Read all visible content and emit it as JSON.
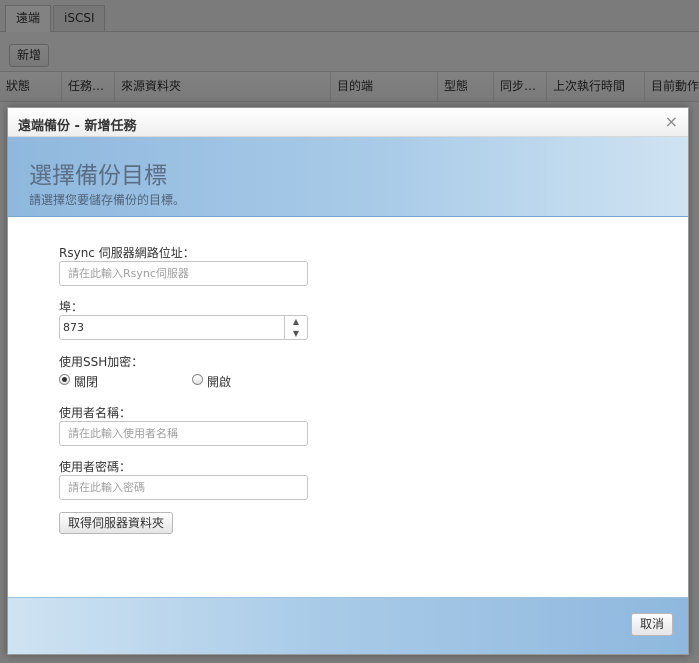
{
  "tabs": [
    {
      "label": "遠端",
      "active": true
    },
    {
      "label": "iSCSI",
      "active": false
    }
  ],
  "toolbar": {
    "add_label": "新增"
  },
  "grid": {
    "columns": [
      "狀態",
      "任務…",
      "來源資料夾",
      "目的端",
      "型態",
      "同步…",
      "上次執行時間",
      "目前動作"
    ]
  },
  "dialog": {
    "title": "遠端備份 - 新增任務",
    "close_icon": "×",
    "banner_title": "選擇備份目標",
    "banner_subtitle": "請選擇您要儲存備份的目標。",
    "server": {
      "label": "Rsync 伺服器網路位址：",
      "placeholder": "請在此輸入Rsync伺服器",
      "value": ""
    },
    "port": {
      "label": "埠：",
      "value": "873"
    },
    "ssh": {
      "label": "使用SSH加密：",
      "options": [
        {
          "label": "關閉",
          "checked": true
        },
        {
          "label": "開啟",
          "checked": false
        }
      ]
    },
    "username": {
      "label": "使用者名稱：",
      "placeholder": "請在此輸入使用者名稱",
      "value": ""
    },
    "password": {
      "label": "使用者密碼：",
      "placeholder": "請在此輸入密碼",
      "value": ""
    },
    "fetch_folders_label": "取得伺服器資料夾",
    "cancel_label": "取消"
  },
  "colors": {
    "banner_gradient": [
      "#8fb8de",
      "#cfe3f2"
    ],
    "overlay": "#7f7f7f",
    "banner_title": "#5a6f86"
  }
}
